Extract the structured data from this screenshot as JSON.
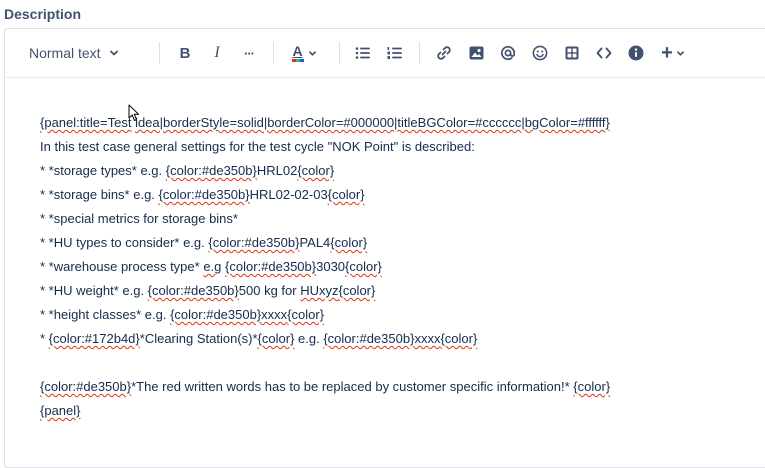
{
  "field_label": "Description",
  "toolbar": {
    "text_style": "Normal text",
    "bold": "B",
    "italic": "I",
    "more": "···",
    "text_color": "A",
    "text_color_bar": "#172b4d",
    "plus": "+"
  },
  "lines": [
    {
      "parts": [
        {
          "t": "{panel:title=Test",
          "s": 1
        },
        {
          "t": " ",
          "s": 0
        },
        {
          "t": "idea|borderStyle=solid|borderColor=#000000|titleBGColor=#cccccc|bgColor=#ffffff}",
          "s": 1
        }
      ]
    },
    {
      "parts": [
        {
          "t": "In this test case general settings for the test cycle \"NOK Point\" is described:",
          "s": 0
        }
      ]
    },
    {
      "parts": [
        {
          "t": "* *storage types* e.g. ",
          "s": 0
        },
        {
          "t": "{color:#de350b}",
          "s": 1
        },
        {
          "t": "HRL02",
          "s": 0
        },
        {
          "t": "{color}",
          "s": 1
        }
      ]
    },
    {
      "parts": [
        {
          "t": "* *storage bins* e.g. ",
          "s": 0
        },
        {
          "t": "{color:#de350b}",
          "s": 1
        },
        {
          "t": "HRL02-02-03",
          "s": 0
        },
        {
          "t": "{color}",
          "s": 1
        }
      ]
    },
    {
      "parts": [
        {
          "t": "* *special metrics for storage bins*",
          "s": 0
        }
      ]
    },
    {
      "parts": [
        {
          "t": "* *HU types to consider* e.g. ",
          "s": 0
        },
        {
          "t": "{color:#de350b}",
          "s": 1
        },
        {
          "t": "PAL4",
          "s": 0
        },
        {
          "t": "{color}",
          "s": 1
        }
      ]
    },
    {
      "parts": [
        {
          "t": "* *warehouse process type* ",
          "s": 0
        },
        {
          "t": "e.g",
          "s": 1
        },
        {
          "t": " ",
          "s": 0
        },
        {
          "t": "{color:#de350b}",
          "s": 1
        },
        {
          "t": "3030",
          "s": 0
        },
        {
          "t": "{color}",
          "s": 1
        }
      ]
    },
    {
      "parts": [
        {
          "t": "* *HU weight* e.g. ",
          "s": 0
        },
        {
          "t": "{color:#de350b}",
          "s": 1
        },
        {
          "t": "500 kg for ",
          "s": 0
        },
        {
          "t": "HUxyz",
          "s": 1
        },
        {
          "t": "{color}",
          "s": 1
        }
      ]
    },
    {
      "parts": [
        {
          "t": "* *height classes* e.g. ",
          "s": 0
        },
        {
          "t": "{color:#de350b}",
          "s": 1
        },
        {
          "t": "xxxx",
          "s": 1
        },
        {
          "t": "{color}",
          "s": 1
        }
      ]
    },
    {
      "parts": [
        {
          "t": "* ",
          "s": 0
        },
        {
          "t": "{color:#172b4d}",
          "s": 1
        },
        {
          "t": "*Clearing Station(s)*",
          "s": 0
        },
        {
          "t": "{color}",
          "s": 1
        },
        {
          "t": " e.g. ",
          "s": 0
        },
        {
          "t": "{color:#de350b}",
          "s": 1
        },
        {
          "t": "xxxx",
          "s": 1
        },
        {
          "t": "{color}",
          "s": 1
        }
      ]
    },
    {
      "parts": []
    },
    {
      "parts": [
        {
          "t": "{color:#de350b}",
          "s": 1
        },
        {
          "t": "*The red written words has to be replaced by customer specific information!* ",
          "s": 0
        },
        {
          "t": "{color}",
          "s": 1
        }
      ]
    },
    {
      "parts": [
        {
          "t": "{panel}",
          "s": 1
        }
      ]
    }
  ]
}
